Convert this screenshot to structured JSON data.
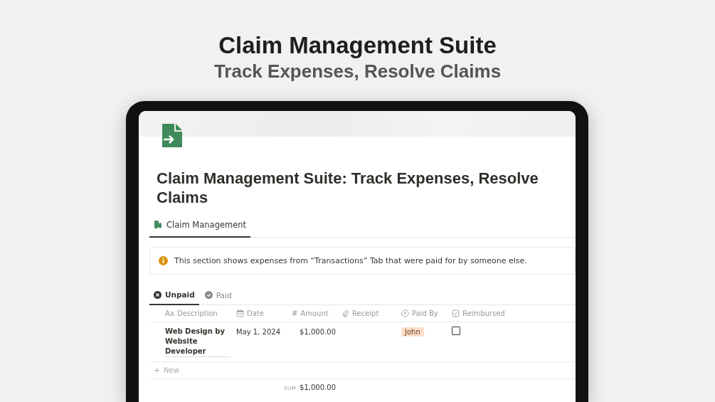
{
  "headline": {
    "title": "Claim Management Suite",
    "subtitle": "Track Expenses, Resolve Claims"
  },
  "page": {
    "title": "Claim Management Suite: Track Expenses, Resolve Claims",
    "tabs": [
      {
        "label": "Claim Management",
        "selected": true
      }
    ],
    "callout": {
      "text": "This section shows expenses from “Transactions” Tab that were paid for by someone else."
    },
    "views": [
      {
        "label": "Unpaid",
        "selected": true
      },
      {
        "label": "Paid",
        "selected": false
      }
    ],
    "table": {
      "columns": [
        {
          "label": "Description",
          "kind": "text",
          "icon_text": "Aa"
        },
        {
          "label": "Date",
          "kind": "date"
        },
        {
          "label": "Amount",
          "kind": "number",
          "icon_text": "#"
        },
        {
          "label": "Receipt",
          "kind": "file"
        },
        {
          "label": "Paid By",
          "kind": "select"
        },
        {
          "label": "Reimbursed",
          "kind": "checkbox"
        }
      ],
      "rows": [
        {
          "description": "Web Design by Website Developer",
          "date": "May 1, 2024",
          "amount": "$1,000.00",
          "paid_by": {
            "label": "John",
            "color": "#fadec9"
          },
          "reimbursed": false
        }
      ],
      "new_label": "New",
      "sum": {
        "label": "SUM",
        "value": "$1,000.00"
      }
    }
  }
}
